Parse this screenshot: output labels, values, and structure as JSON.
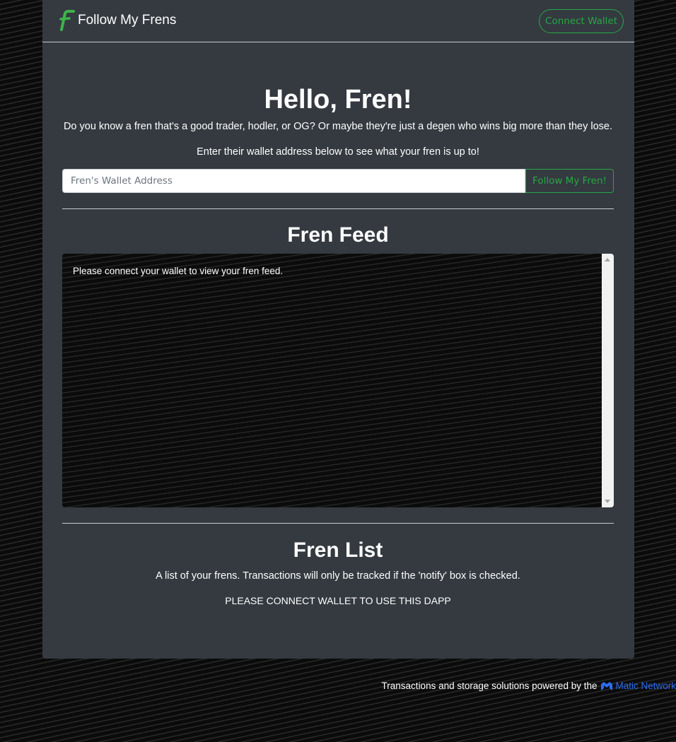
{
  "navbar": {
    "brand_name": "Follow My Frens",
    "connect_label": "Connect Wallet"
  },
  "hero": {
    "title": "Hello, Fren!",
    "intro": "Do you know a fren that's a good trader, hodler, or OG? Or maybe they're just a degen who wins big more than they lose.",
    "instruction": "Enter their wallet address below to see what your fren is up to!"
  },
  "search": {
    "placeholder": "Fren's Wallet Address",
    "value": "",
    "button_label": "Follow My Fren!"
  },
  "feed": {
    "title": "Fren Feed",
    "message": "Please connect your wallet to view your fren feed."
  },
  "list": {
    "title": "Fren List",
    "description": "A list of your frens. Transactions will only be tracked if the 'notify' box is checked.",
    "connect_note": "PLEASE CONNECT WALLET TO USE THIS DAPP"
  },
  "footer": {
    "text": "Transactions and storage solutions powered by the",
    "link_label": "Matic Network"
  },
  "colors": {
    "accent": "#28a745",
    "panel": "#343a40",
    "link": "#2b6def"
  },
  "icons": {
    "brand": "follow-my-frens-logo",
    "matic": "matic-logo-icon"
  }
}
